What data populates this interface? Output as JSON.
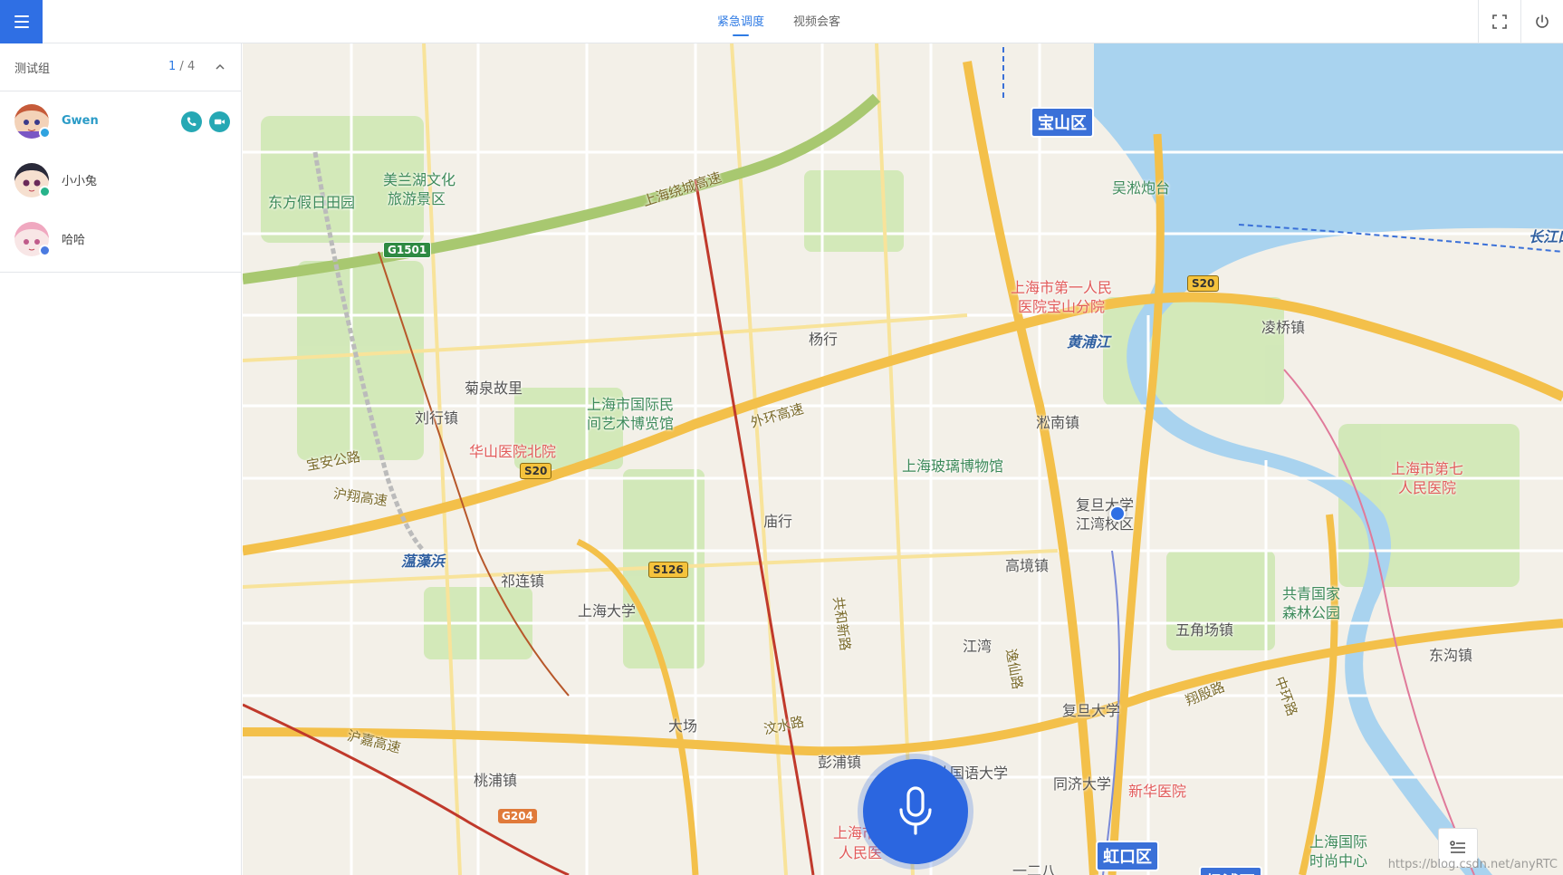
{
  "header": {
    "menu_icon": "menu-icon",
    "tabs": [
      {
        "label": "紧急调度",
        "active": true
      },
      {
        "label": "视频会客",
        "active": false
      }
    ],
    "fullscreen_icon": "fullscreen-icon",
    "power_icon": "power-icon",
    "accent_color": "#2f6fe4"
  },
  "sidebar": {
    "group": {
      "name": "测试组",
      "online": "1",
      "total": "4",
      "separator": " / "
    },
    "members": [
      {
        "name": "Gwen",
        "online": true,
        "actions": [
          "phone-icon",
          "video-icon"
        ]
      },
      {
        "name": "小小兔",
        "online": false
      },
      {
        "name": "哈哈",
        "online": false
      }
    ]
  },
  "map": {
    "districts": [
      "宝山区",
      "虹口区",
      "杨浦区"
    ],
    "places": {
      "p1": "上海绕城高速",
      "p2": "美兰湖文化",
      "p3": "旅游景区",
      "p4": "东方假日田园",
      "p5": "吴淞炮台",
      "p6": "上海市第一人民",
      "p7": "医院宝山分院",
      "p8": "黄浦江",
      "p9": "凌桥镇",
      "p10": "杨行",
      "p11": "菊泉故里",
      "p12": "刘行镇",
      "p13": "上海市国际民",
      "p14": "间艺术博览馆",
      "p15": "华山医院北院",
      "p16": "沪翔高速",
      "p17": "淞南镇",
      "p18": "上海玻璃博物馆",
      "p19": "复旦大学",
      "p20": "江湾校区",
      "p21": "上海市第七",
      "p22": "人民医院",
      "p23": "庙行",
      "p24": "蕰藻浜",
      "p25": "祁连镇",
      "p26": "上海大学",
      "p27": "高境镇",
      "p28": "共青国家",
      "p29": "森林公园",
      "p30": "五角场镇",
      "p31": "东沟镇",
      "p32": "江湾",
      "p33": "复旦大学",
      "p34": "大场",
      "p35": "汶水路",
      "p36": "彭浦镇",
      "p37": "沪嘉高速",
      "p38": "桃浦镇",
      "p39": "同济大学",
      "p40": "新华医院",
      "p41": "外国语大学",
      "p42": "上海市",
      "p43": "人民医",
      "p44": "上海国际",
      "p45": "时尚中心",
      "p46": "长江口",
      "p47": "外环高速",
      "p48": "宝安公路",
      "p49": "共和新路",
      "p50": "中环路",
      "p51": "逸仙路",
      "p52": "翔殷路",
      "p53": "一二八"
    },
    "shields": [
      "G1501",
      "S20",
      "S20",
      "S126",
      "G204"
    ],
    "mic_icon": "microphone-icon",
    "list_icon": "list-icon",
    "watermark": "https://blog.csdn.net/anyRTC"
  }
}
